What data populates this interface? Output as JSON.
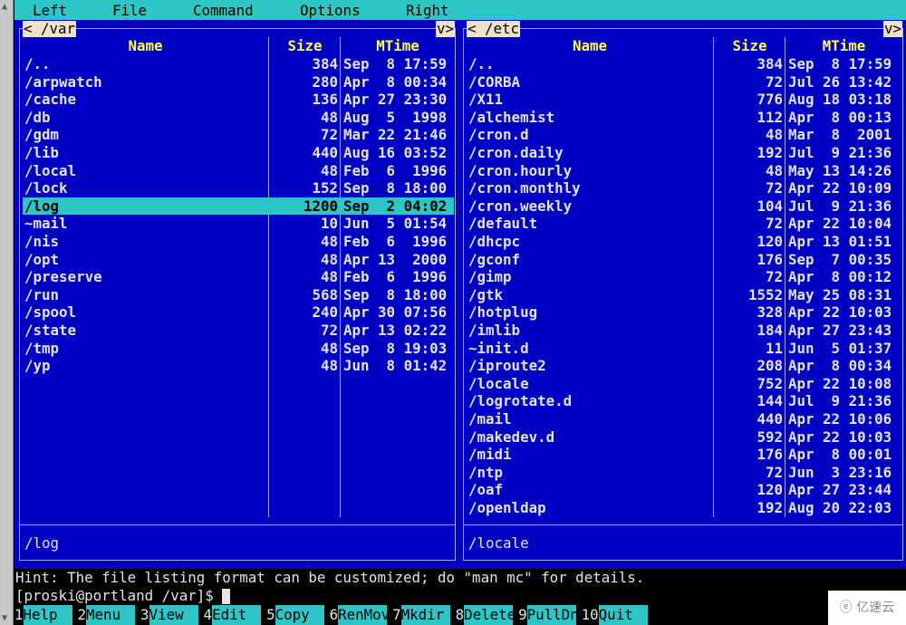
{
  "colors": {
    "panel_bg": "#0000c4",
    "menu_bg": "#2cc6c6",
    "header": "#ffff4c",
    "selection": "#2cc6c6"
  },
  "menu": [
    "Left",
    "File",
    "Command",
    "Options",
    "Right"
  ],
  "left": {
    "path": "/var",
    "arrow_left": "<",
    "arrow_right": "v>",
    "headers": {
      "name": "Name",
      "size": "Size",
      "mtime": "MTime"
    },
    "selected": 8,
    "status": "/log",
    "files": [
      [
        "/..",
        "384",
        "Sep  8 17:59"
      ],
      [
        "/arpwatch",
        "280",
        "Apr  8 00:34"
      ],
      [
        "/cache",
        "136",
        "Apr 27 23:30"
      ],
      [
        "/db",
        "48",
        "Aug  5  1998"
      ],
      [
        "/gdm",
        "72",
        "Mar 22 21:46"
      ],
      [
        "/lib",
        "440",
        "Aug 16 03:52"
      ],
      [
        "/local",
        "48",
        "Feb  6  1996"
      ],
      [
        "/lock",
        "152",
        "Sep  8 18:00"
      ],
      [
        "/log",
        "1200",
        "Sep  2 04:02"
      ],
      [
        "~mail",
        "10",
        "Jun  5 01:54"
      ],
      [
        "/nis",
        "48",
        "Feb  6  1996"
      ],
      [
        "/opt",
        "48",
        "Apr 13  2000"
      ],
      [
        "/preserve",
        "48",
        "Feb  6  1996"
      ],
      [
        "/run",
        "568",
        "Sep  8 18:00"
      ],
      [
        "/spool",
        "240",
        "Apr 30 07:56"
      ],
      [
        "/state",
        "72",
        "Apr 13 02:22"
      ],
      [
        "/tmp",
        "48",
        "Sep  8 19:03"
      ],
      [
        "/yp",
        "48",
        "Jun  8 01:42"
      ]
    ]
  },
  "right": {
    "path": "/etc",
    "arrow_left": "<",
    "arrow_right": "v>",
    "headers": {
      "name": "Name",
      "size": "Size",
      "mtime": "MTime"
    },
    "selected": -1,
    "status": "/locale",
    "files": [
      [
        "/..",
        "384",
        "Sep  8 17:59"
      ],
      [
        "/CORBA",
        "72",
        "Jul 26 13:42"
      ],
      [
        "/X11",
        "776",
        "Aug 18 03:18"
      ],
      [
        "/alchemist",
        "112",
        "Apr  8 00:13"
      ],
      [
        "/cron.d",
        "48",
        "Mar  8  2001"
      ],
      [
        "/cron.daily",
        "192",
        "Jul  9 21:36"
      ],
      [
        "/cron.hourly",
        "48",
        "May 13 14:26"
      ],
      [
        "/cron.monthly",
        "72",
        "Apr 22 10:09"
      ],
      [
        "/cron.weekly",
        "104",
        "Jul  9 21:36"
      ],
      [
        "/default",
        "72",
        "Apr 22 10:04"
      ],
      [
        "/dhcpc",
        "120",
        "Apr 13 01:51"
      ],
      [
        "/gconf",
        "176",
        "Sep  7 00:35"
      ],
      [
        "/gimp",
        "72",
        "Apr  8 00:12"
      ],
      [
        "/gtk",
        "1552",
        "May 25 08:31"
      ],
      [
        "/hotplug",
        "328",
        "Apr 22 10:03"
      ],
      [
        "/imlib",
        "184",
        "Apr 27 23:43"
      ],
      [
        "~init.d",
        "11",
        "Jun  5 01:37"
      ],
      [
        "/iproute2",
        "208",
        "Apr  8 00:34"
      ],
      [
        "/locale",
        "752",
        "Apr 22 10:08"
      ],
      [
        "/logrotate.d",
        "144",
        "Jul  9 21:36"
      ],
      [
        "/mail",
        "440",
        "Apr 22 10:06"
      ],
      [
        "/makedev.d",
        "592",
        "Apr 22 10:03"
      ],
      [
        "/midi",
        "176",
        "Apr  8 00:01"
      ],
      [
        "/ntp",
        "72",
        "Jun  3 23:16"
      ],
      [
        "/oaf",
        "120",
        "Apr 27 23:44"
      ],
      [
        "/openldap",
        "192",
        "Aug 20 22:03"
      ]
    ]
  },
  "hint": "Hint: The file listing format can be customized; do \"man mc\" for details.",
  "prompt": "[proski@portland /var]$ ",
  "fkeys": [
    [
      "1",
      "Help"
    ],
    [
      "2",
      "Menu"
    ],
    [
      "3",
      "View"
    ],
    [
      "4",
      "Edit"
    ],
    [
      "5",
      "Copy"
    ],
    [
      "6",
      "RenMov"
    ],
    [
      "7",
      "Mkdir"
    ],
    [
      "8",
      "Delete"
    ],
    [
      "9",
      "PullDn"
    ],
    [
      "10",
      "Quit"
    ]
  ],
  "watermark": "亿速云"
}
